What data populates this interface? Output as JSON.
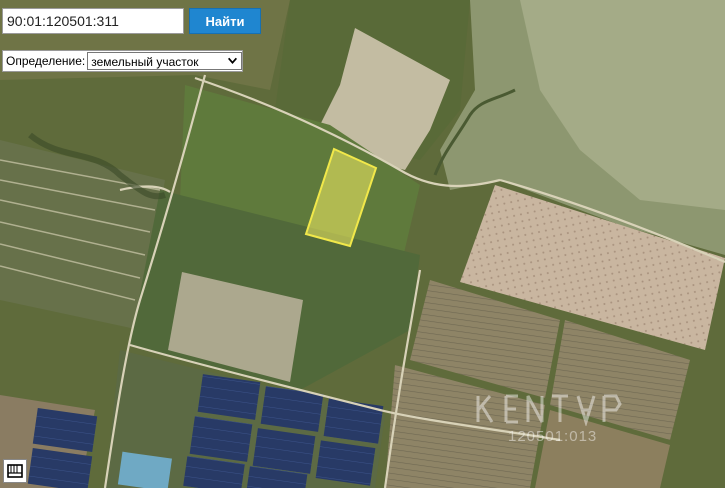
{
  "search": {
    "value": "90:01:120501:311",
    "button_label": "Найти"
  },
  "definition": {
    "label": "Определение:",
    "selected": "земельный участок"
  },
  "watermark": {
    "id_text": "120501:013"
  },
  "icons": {
    "dropdown": "chevron-down-icon",
    "layers": "layers-icon"
  },
  "colors": {
    "parcel_fill": "#f4ef63",
    "parcel_stroke": "#f1e84a",
    "search_button": "#1f86d0"
  }
}
